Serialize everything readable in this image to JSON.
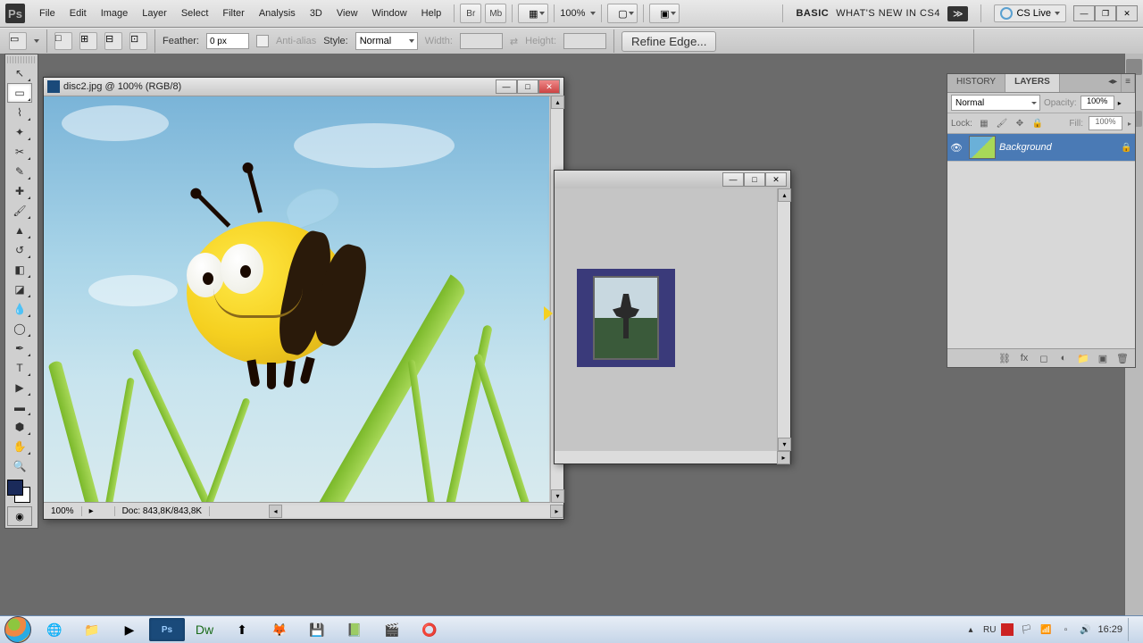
{
  "menubar": {
    "items": [
      "File",
      "Edit",
      "Image",
      "Layer",
      "Select",
      "Filter",
      "Analysis",
      "3D",
      "View",
      "Window",
      "Help"
    ],
    "zoom": "100%",
    "workspace_basic": "BASIC",
    "workspace_new": "WHAT'S NEW IN CS4",
    "cslive": "CS Live"
  },
  "options": {
    "feather_label": "Feather:",
    "feather_value": "0 px",
    "antialias_label": "Anti-alias",
    "style_label": "Style:",
    "style_value": "Normal",
    "width_label": "Width:",
    "height_label": "Height:",
    "refine": "Refine Edge..."
  },
  "document": {
    "title": "disc2.jpg @ 100% (RGB/8)",
    "zoom": "100%",
    "doc_info": "Doc: 843,8K/843,8K"
  },
  "panels": {
    "tabs": [
      "HISTORY",
      "LAYERS"
    ],
    "blend_mode": "Normal",
    "opacity_label": "Opacity:",
    "opacity_value": "100%",
    "lock_label": "Lock:",
    "fill_label": "Fill:",
    "fill_value": "100%",
    "layer_name": "Background"
  },
  "taskbar": {
    "lang": "RU",
    "time": "16:29"
  }
}
